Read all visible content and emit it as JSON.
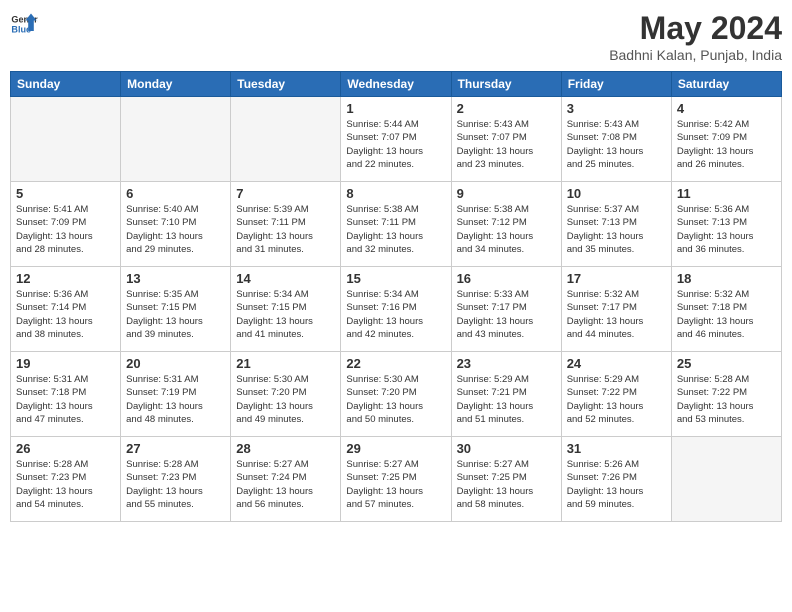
{
  "header": {
    "logo_general": "General",
    "logo_blue": "Blue",
    "month_title": "May 2024",
    "location": "Badhni Kalan, Punjab, India"
  },
  "days_of_week": [
    "Sunday",
    "Monday",
    "Tuesday",
    "Wednesday",
    "Thursday",
    "Friday",
    "Saturday"
  ],
  "weeks": [
    [
      {
        "day": "",
        "info": "",
        "empty": true
      },
      {
        "day": "",
        "info": "",
        "empty": true
      },
      {
        "day": "",
        "info": "",
        "empty": true
      },
      {
        "day": "1",
        "info": "Sunrise: 5:44 AM\nSunset: 7:07 PM\nDaylight: 13 hours\nand 22 minutes.",
        "empty": false
      },
      {
        "day": "2",
        "info": "Sunrise: 5:43 AM\nSunset: 7:07 PM\nDaylight: 13 hours\nand 23 minutes.",
        "empty": false
      },
      {
        "day": "3",
        "info": "Sunrise: 5:43 AM\nSunset: 7:08 PM\nDaylight: 13 hours\nand 25 minutes.",
        "empty": false
      },
      {
        "day": "4",
        "info": "Sunrise: 5:42 AM\nSunset: 7:09 PM\nDaylight: 13 hours\nand 26 minutes.",
        "empty": false
      }
    ],
    [
      {
        "day": "5",
        "info": "Sunrise: 5:41 AM\nSunset: 7:09 PM\nDaylight: 13 hours\nand 28 minutes.",
        "empty": false
      },
      {
        "day": "6",
        "info": "Sunrise: 5:40 AM\nSunset: 7:10 PM\nDaylight: 13 hours\nand 29 minutes.",
        "empty": false
      },
      {
        "day": "7",
        "info": "Sunrise: 5:39 AM\nSunset: 7:11 PM\nDaylight: 13 hours\nand 31 minutes.",
        "empty": false
      },
      {
        "day": "8",
        "info": "Sunrise: 5:38 AM\nSunset: 7:11 PM\nDaylight: 13 hours\nand 32 minutes.",
        "empty": false
      },
      {
        "day": "9",
        "info": "Sunrise: 5:38 AM\nSunset: 7:12 PM\nDaylight: 13 hours\nand 34 minutes.",
        "empty": false
      },
      {
        "day": "10",
        "info": "Sunrise: 5:37 AM\nSunset: 7:13 PM\nDaylight: 13 hours\nand 35 minutes.",
        "empty": false
      },
      {
        "day": "11",
        "info": "Sunrise: 5:36 AM\nSunset: 7:13 PM\nDaylight: 13 hours\nand 36 minutes.",
        "empty": false
      }
    ],
    [
      {
        "day": "12",
        "info": "Sunrise: 5:36 AM\nSunset: 7:14 PM\nDaylight: 13 hours\nand 38 minutes.",
        "empty": false
      },
      {
        "day": "13",
        "info": "Sunrise: 5:35 AM\nSunset: 7:15 PM\nDaylight: 13 hours\nand 39 minutes.",
        "empty": false
      },
      {
        "day": "14",
        "info": "Sunrise: 5:34 AM\nSunset: 7:15 PM\nDaylight: 13 hours\nand 41 minutes.",
        "empty": false
      },
      {
        "day": "15",
        "info": "Sunrise: 5:34 AM\nSunset: 7:16 PM\nDaylight: 13 hours\nand 42 minutes.",
        "empty": false
      },
      {
        "day": "16",
        "info": "Sunrise: 5:33 AM\nSunset: 7:17 PM\nDaylight: 13 hours\nand 43 minutes.",
        "empty": false
      },
      {
        "day": "17",
        "info": "Sunrise: 5:32 AM\nSunset: 7:17 PM\nDaylight: 13 hours\nand 44 minutes.",
        "empty": false
      },
      {
        "day": "18",
        "info": "Sunrise: 5:32 AM\nSunset: 7:18 PM\nDaylight: 13 hours\nand 46 minutes.",
        "empty": false
      }
    ],
    [
      {
        "day": "19",
        "info": "Sunrise: 5:31 AM\nSunset: 7:18 PM\nDaylight: 13 hours\nand 47 minutes.",
        "empty": false
      },
      {
        "day": "20",
        "info": "Sunrise: 5:31 AM\nSunset: 7:19 PM\nDaylight: 13 hours\nand 48 minutes.",
        "empty": false
      },
      {
        "day": "21",
        "info": "Sunrise: 5:30 AM\nSunset: 7:20 PM\nDaylight: 13 hours\nand 49 minutes.",
        "empty": false
      },
      {
        "day": "22",
        "info": "Sunrise: 5:30 AM\nSunset: 7:20 PM\nDaylight: 13 hours\nand 50 minutes.",
        "empty": false
      },
      {
        "day": "23",
        "info": "Sunrise: 5:29 AM\nSunset: 7:21 PM\nDaylight: 13 hours\nand 51 minutes.",
        "empty": false
      },
      {
        "day": "24",
        "info": "Sunrise: 5:29 AM\nSunset: 7:22 PM\nDaylight: 13 hours\nand 52 minutes.",
        "empty": false
      },
      {
        "day": "25",
        "info": "Sunrise: 5:28 AM\nSunset: 7:22 PM\nDaylight: 13 hours\nand 53 minutes.",
        "empty": false
      }
    ],
    [
      {
        "day": "26",
        "info": "Sunrise: 5:28 AM\nSunset: 7:23 PM\nDaylight: 13 hours\nand 54 minutes.",
        "empty": false
      },
      {
        "day": "27",
        "info": "Sunrise: 5:28 AM\nSunset: 7:23 PM\nDaylight: 13 hours\nand 55 minutes.",
        "empty": false
      },
      {
        "day": "28",
        "info": "Sunrise: 5:27 AM\nSunset: 7:24 PM\nDaylight: 13 hours\nand 56 minutes.",
        "empty": false
      },
      {
        "day": "29",
        "info": "Sunrise: 5:27 AM\nSunset: 7:25 PM\nDaylight: 13 hours\nand 57 minutes.",
        "empty": false
      },
      {
        "day": "30",
        "info": "Sunrise: 5:27 AM\nSunset: 7:25 PM\nDaylight: 13 hours\nand 58 minutes.",
        "empty": false
      },
      {
        "day": "31",
        "info": "Sunrise: 5:26 AM\nSunset: 7:26 PM\nDaylight: 13 hours\nand 59 minutes.",
        "empty": false
      },
      {
        "day": "",
        "info": "",
        "empty": true
      }
    ]
  ]
}
